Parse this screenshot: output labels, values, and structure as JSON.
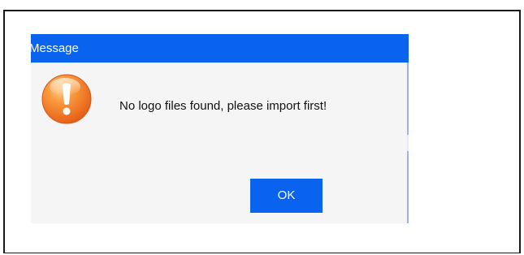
{
  "dialog": {
    "title": "Message",
    "message": "No logo files found, please import first!",
    "ok_label": "OK",
    "icon": "warning-icon"
  },
  "colors": {
    "title_bar": "#0a63ee",
    "button": "#0a63ee",
    "dialog_background": "#f5f5f5",
    "icon_orange": "#f3781f"
  }
}
